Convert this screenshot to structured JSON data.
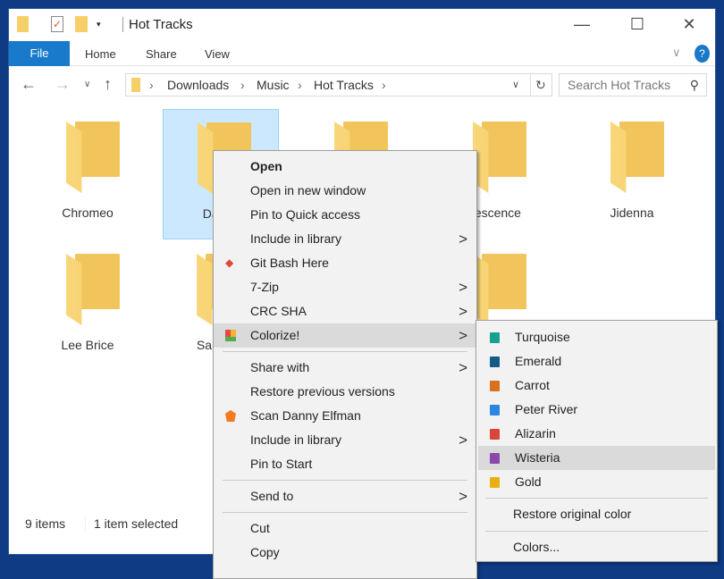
{
  "window": {
    "title": "Hot Tracks",
    "controls": {
      "minimize": "—",
      "maximize": "☐",
      "close": "✕"
    }
  },
  "ribbon": {
    "file": "File",
    "tabs": [
      "Home",
      "Share",
      "View"
    ]
  },
  "address": {
    "crumbs": [
      "Downloads",
      "Music",
      "Hot Tracks"
    ],
    "search_placeholder": "Search Hot Tracks"
  },
  "folders": [
    {
      "name": "Chromeo"
    },
    {
      "name": "Danny",
      "selected": true
    },
    {
      "name": ""
    },
    {
      "name": "nescence"
    },
    {
      "name": "Jidenna"
    },
    {
      "name": "Lee Brice"
    },
    {
      "name": "Sabrina"
    },
    {
      "name": ""
    },
    {
      "name": ""
    }
  ],
  "status": {
    "count": "9 items",
    "selected": "1 item selected"
  },
  "context_menu": {
    "items": [
      {
        "label": "Open",
        "bold": true
      },
      {
        "label": "Open in new window"
      },
      {
        "label": "Pin to Quick access"
      },
      {
        "label": "Include in library",
        "submenu": true
      },
      {
        "label": "Git Bash Here",
        "icon": "git-icon"
      },
      {
        "label": "7-Zip",
        "submenu": true
      },
      {
        "label": "CRC SHA",
        "submenu": true
      },
      {
        "label": "Colorize!",
        "icon": "colorize-icon",
        "submenu": true,
        "highlighted": true
      },
      {
        "label": "Share with",
        "submenu": true
      },
      {
        "label": "Restore previous versions"
      },
      {
        "label": "Scan Danny Elfman",
        "icon": "avast-icon"
      },
      {
        "label": "Include in library",
        "submenu": true
      },
      {
        "label": "Pin to Start"
      },
      {
        "label": "Send to",
        "submenu": true
      },
      {
        "label": "Cut"
      },
      {
        "label": "Copy"
      }
    ]
  },
  "colorize_menu": {
    "colors": [
      {
        "label": "Turquoise",
        "color": "#1a9e8f"
      },
      {
        "label": "Emerald",
        "color": "#145a86"
      },
      {
        "label": "Carrot",
        "color": "#d9701f"
      },
      {
        "label": "Peter River",
        "color": "#2b86e0"
      },
      {
        "label": "Alizarin",
        "color": "#d9453a"
      },
      {
        "label": "Wisteria",
        "color": "#8a48a8",
        "highlighted": true
      },
      {
        "label": "Gold",
        "color": "#e8b010"
      }
    ],
    "restore": "Restore original color",
    "more": "Colors..."
  }
}
